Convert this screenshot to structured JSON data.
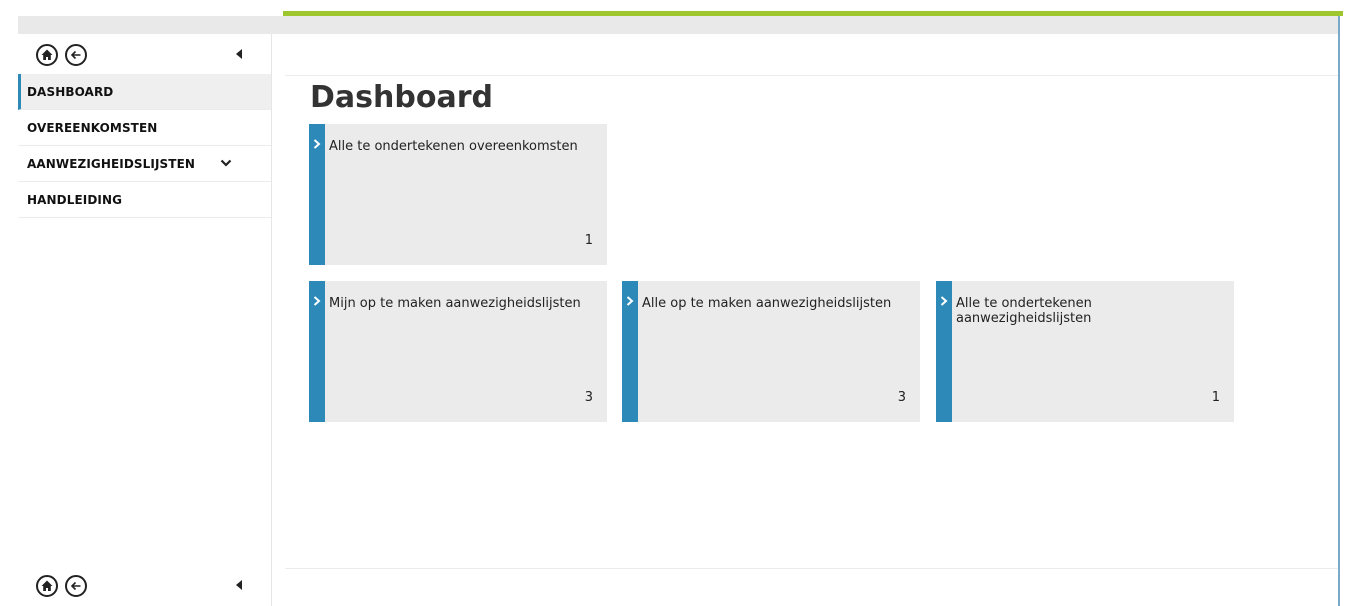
{
  "colors": {
    "accent_blue": "#2d89b7",
    "green_bar": "#9ec72e",
    "tile_bg": "#ebebeb",
    "active_nav_bg": "#efefef"
  },
  "sidebar": {
    "icons": [
      "home-icon",
      "back-arrow-icon",
      "collapse-arrow-icon"
    ],
    "items": [
      {
        "label": "DASHBOARD",
        "active": true
      },
      {
        "label": "OVEREENKOMSTEN",
        "active": false
      },
      {
        "label": "AANWEZIGHEIDSLIJSTEN",
        "active": false,
        "expandable": true
      },
      {
        "label": "HANDLEIDING",
        "active": false
      }
    ]
  },
  "main": {
    "title": "Dashboard",
    "tiles": [
      {
        "label": "Alle te ondertekenen overeenkomsten",
        "count": "1"
      },
      {
        "label": "Mijn op te maken aanwezigheidslijsten",
        "count": "3"
      },
      {
        "label": "Alle op te maken aanwezigheidslijsten",
        "count": "3"
      },
      {
        "label": "Alle te ondertekenen aanwezigheidslijsten",
        "count": "1"
      }
    ]
  }
}
